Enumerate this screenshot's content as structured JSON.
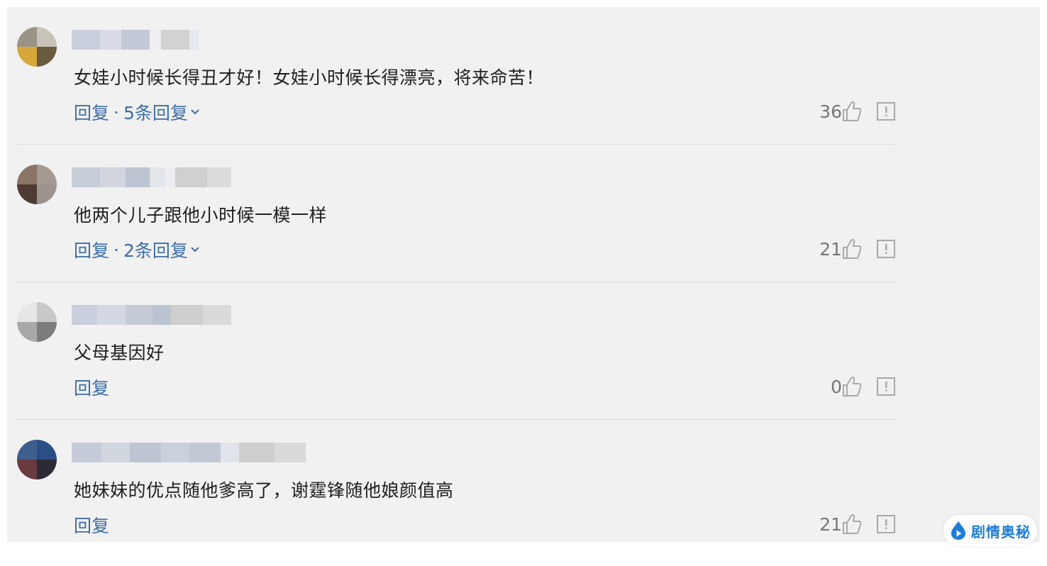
{
  "comments": [
    {
      "text": "女娃小时候长得丑才好！女娃小时候长得漂亮，将来命苦！",
      "reply_label": "回复",
      "separator": "·",
      "replies_label": "5条回复",
      "likes": "36"
    },
    {
      "text": "他两个儿子跟他小时候一模一样",
      "reply_label": "回复",
      "separator": "·",
      "replies_label": "2条回复",
      "likes": "21"
    },
    {
      "text": "父母基因好",
      "reply_label": "回复",
      "likes": "0"
    },
    {
      "text": "她妹妹的优点随他爹高了，谢霆锋随他娘颜值高",
      "reply_label": "回复",
      "likes": "21"
    }
  ],
  "icons": {
    "like": "thumbs-up-icon",
    "report": "report-icon",
    "expand": "chevron-down-icon"
  },
  "watermark": {
    "text": "剧情奥秘"
  },
  "colors": {
    "link": "#3d6ea8",
    "background": "#f1f1f1",
    "text": "#1f1f1f",
    "muted": "#777777",
    "watermark": "#1e7ed6"
  }
}
